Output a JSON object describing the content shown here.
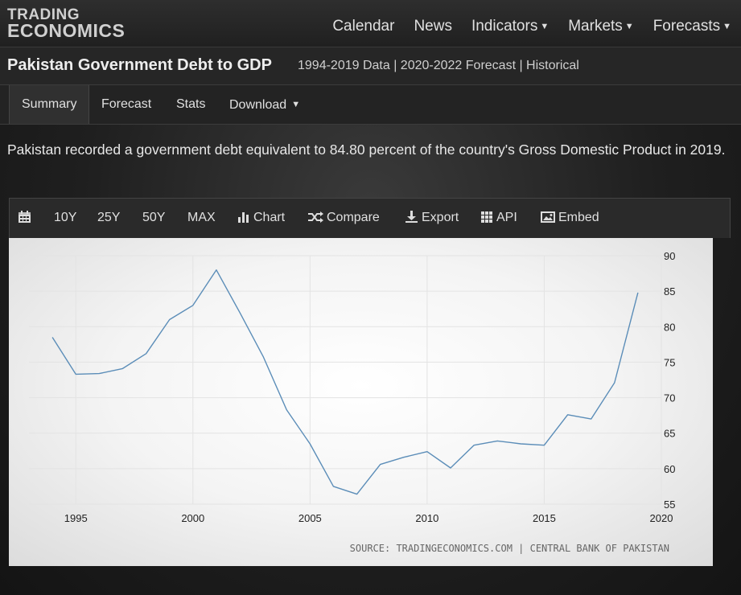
{
  "logo": {
    "line1": "TRADING",
    "line2": "ECONOMICS"
  },
  "nav": [
    {
      "label": "Calendar",
      "dropdown": false
    },
    {
      "label": "News",
      "dropdown": false
    },
    {
      "label": "Indicators",
      "dropdown": true
    },
    {
      "label": "Markets",
      "dropdown": true
    },
    {
      "label": "Forecasts",
      "dropdown": true
    }
  ],
  "page": {
    "title": "Pakistan Government Debt to GDP",
    "subtitle": "1994-2019 Data | 2020-2022 Forecast | Historical"
  },
  "tabs": {
    "summary": "Summary",
    "forecast": "Forecast",
    "stats": "Stats",
    "download": "Download"
  },
  "description": "Pakistan recorded a government debt equivalent to 84.80 percent of the country's Gross Domestic Product in 2019.",
  "toolbar": {
    "calendar_icon": "calendar-icon",
    "r10": "10Y",
    "r25": "25Y",
    "r50": "50Y",
    "max": "MAX",
    "chart": "Chart",
    "compare": "Compare",
    "export": "Export",
    "api": "API",
    "embed": "Embed"
  },
  "colors": {
    "line": "#5b8db8",
    "grid": "#e3e3e3"
  },
  "chart_data": {
    "type": "line",
    "title": "",
    "xlabel": "",
    "ylabel": "",
    "x": [
      1994,
      1995,
      1996,
      1997,
      1998,
      1999,
      2000,
      2001,
      2002,
      2003,
      2004,
      2005,
      2006,
      2007,
      2008,
      2009,
      2010,
      2011,
      2012,
      2013,
      2014,
      2015,
      2016,
      2017,
      2018,
      2019
    ],
    "series": [
      {
        "values": [
          78.5,
          73.3,
          73.4,
          74.1,
          76.2,
          81.0,
          83.0,
          88.0,
          82.0,
          75.8,
          68.3,
          63.5,
          57.5,
          56.4,
          60.6,
          61.6,
          62.4,
          60.1,
          63.3,
          63.9,
          63.5,
          63.3,
          67.6,
          67.0,
          72.1,
          84.8
        ]
      }
    ],
    "xlim": [
      1993,
      2020
    ],
    "ylim": [
      55,
      90
    ],
    "xticks": [
      "1995",
      "2000",
      "2005",
      "2010",
      "2015",
      "2020"
    ],
    "yticks": [
      "55",
      "60",
      "65",
      "70",
      "75",
      "80",
      "85",
      "90"
    ],
    "y_axis_side": "right",
    "grid": true,
    "source": "SOURCE: TRADINGECONOMICS.COM | CENTRAL BANK OF PAKISTAN"
  }
}
